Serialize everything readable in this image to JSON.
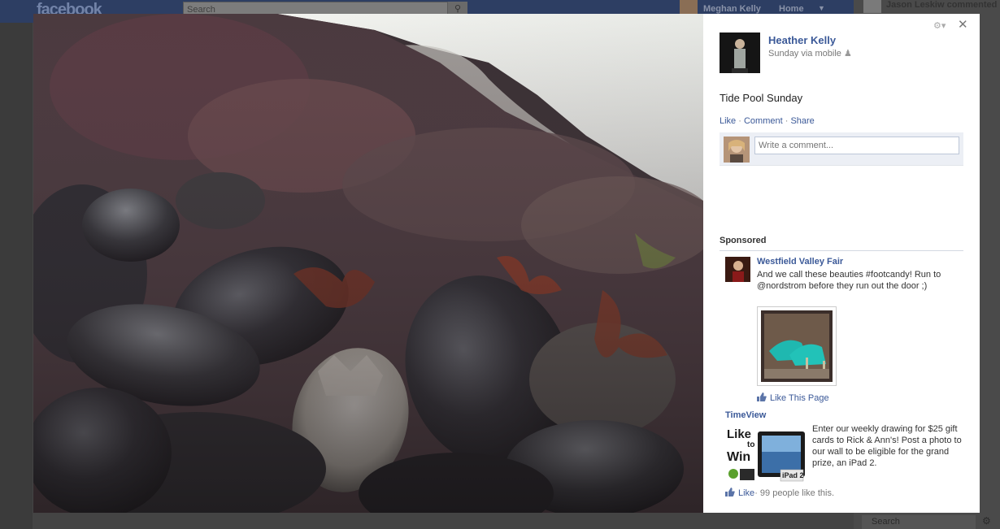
{
  "background": {
    "logo": "facebook",
    "search_placeholder": "Search",
    "user_name": "Meghan Kelly",
    "home": "Home",
    "ticker_name": "Jason Leskiw commented",
    "chat_search": "Search"
  },
  "viewer": {
    "owner": {
      "name": "Heather Kelly",
      "meta": "Sunday via mobile"
    },
    "caption": "Tide Pool Sunday",
    "actions": {
      "like": "Like",
      "comment": "Comment",
      "share": "Share",
      "separator": " · "
    },
    "comment_placeholder": "Write a comment...",
    "sponsored": {
      "title": "Sponsored",
      "ads": [
        {
          "title": "Westfield Valley Fair",
          "body": "And we call these beauties #footcandy! Run to @nordstrom before they run out the door ;)",
          "like_label": "Like This Page"
        },
        {
          "title": "TimeView",
          "image_text_1": "Like",
          "image_text_2": "to",
          "image_text_3": "Win",
          "image_badge": "iPad 2",
          "body": "Enter our weekly drawing for $25 gift cards to Rick & Ann's! Post a photo to our wall to be eligible for the grand prize, an iPad 2.",
          "like_label": "Like",
          "like_count": "· 99 people like this."
        }
      ]
    }
  },
  "colors": {
    "link": "#3b5998",
    "topbar": "#2d3e63"
  }
}
